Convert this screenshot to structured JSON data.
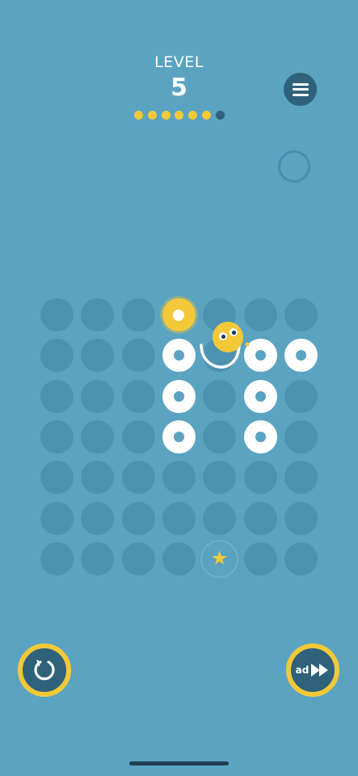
{
  "level": {
    "label": "LEVEL",
    "number": "5"
  },
  "progress": {
    "total": 7,
    "completed": 6,
    "colors": {
      "done": "#f3c93a",
      "pending": "#2f627a"
    }
  },
  "menu": {
    "icon": "hamburger-menu-icon"
  },
  "board": {
    "rows": 7,
    "cols": 7,
    "cells": [
      [
        "empty",
        "empty",
        "empty",
        "active",
        "empty",
        "empty",
        "empty"
      ],
      [
        "empty",
        "empty",
        "empty",
        "ring",
        "empty",
        "ring",
        "ring"
      ],
      [
        "empty",
        "empty",
        "empty",
        "ring",
        "empty",
        "ring",
        "empty"
      ],
      [
        "empty",
        "empty",
        "empty",
        "ring",
        "empty",
        "ring",
        "empty"
      ],
      [
        "empty",
        "empty",
        "empty",
        "empty",
        "empty",
        "empty",
        "empty"
      ],
      [
        "empty",
        "empty",
        "empty",
        "empty",
        "empty",
        "empty",
        "empty"
      ],
      [
        "empty",
        "empty",
        "empty",
        "empty",
        "star",
        "empty",
        "empty"
      ]
    ],
    "star_glyph": "★",
    "character": "yellow-ball-character"
  },
  "controls": {
    "restart": {
      "icon": "restart-icon"
    },
    "skip": {
      "label": "ad",
      "icon": "fast-forward-icon"
    }
  },
  "colors": {
    "background": "#5aa3c1",
    "empty_cell": "#4d92b0",
    "accent_yellow": "#f3c93a",
    "dark_blue": "#2f627a",
    "white": "#ffffff"
  }
}
